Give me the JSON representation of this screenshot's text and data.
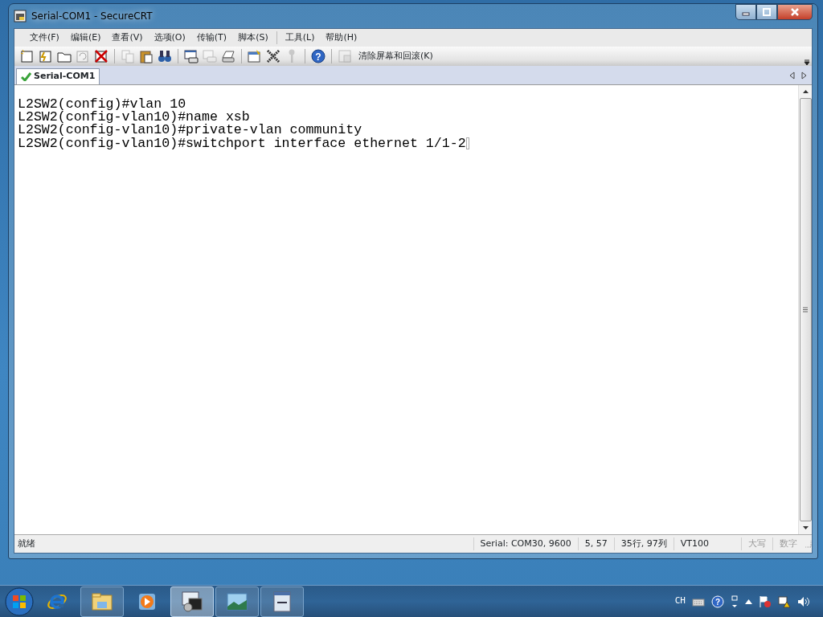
{
  "window": {
    "title": "Serial-COM1 - SecureCRT"
  },
  "menu": [
    "文件(F)",
    "编辑(E)",
    "查看(V)",
    "选项(O)",
    "传输(T)",
    "脚本(S)",
    "工具(L)",
    "帮助(H)"
  ],
  "toolbar": {
    "buttons": [
      {
        "disabled": false
      },
      {
        "disabled": false
      },
      {
        "disabled": false
      },
      {
        "disabled": true
      },
      {
        "disabled": false
      },
      {
        "disabled": true
      },
      {
        "disabled": false
      },
      {
        "disabled": false
      },
      {
        "disabled": false
      },
      {
        "disabled": true
      },
      {
        "disabled": false
      },
      {
        "disabled": false
      },
      {
        "disabled": false
      },
      {
        "disabled": true
      },
      {
        "disabled": false
      },
      {
        "disabled": true
      }
    ],
    "help_glyph": "?",
    "label": "清除屏幕和回滚(K)"
  },
  "tabs": [
    {
      "label": "Serial-COM1",
      "selected": true
    }
  ],
  "terminal": {
    "lines": [
      "L2SW2(config)#vlan 10",
      "L2SW2(config-vlan10)#name xsb",
      "L2SW2(config-vlan10)#private-vlan community",
      "L2SW2(config-vlan10)#switchport interface ethernet 1/1-2"
    ]
  },
  "status_bar": {
    "message": "就绪",
    "fields": [
      {
        "text": "Serial: COM30, 9600",
        "disabled": false
      },
      {
        "text": "5,  57",
        "disabled": false
      },
      {
        "text": "35行, 97列",
        "disabled": false
      },
      {
        "text": "VT100",
        "disabled": false
      },
      {
        "text": "大写",
        "disabled": true
      },
      {
        "text": "数字",
        "disabled": true
      }
    ]
  },
  "taskbar": {
    "apps": [
      {
        "active": false,
        "open": false
      },
      {
        "active": false,
        "open": true
      },
      {
        "active": false,
        "open": false
      },
      {
        "active": true,
        "open": true
      },
      {
        "active": false,
        "open": true
      },
      {
        "active": false,
        "open": true
      }
    ],
    "tray": {
      "language": "CH",
      "help_glyph": "?"
    }
  }
}
